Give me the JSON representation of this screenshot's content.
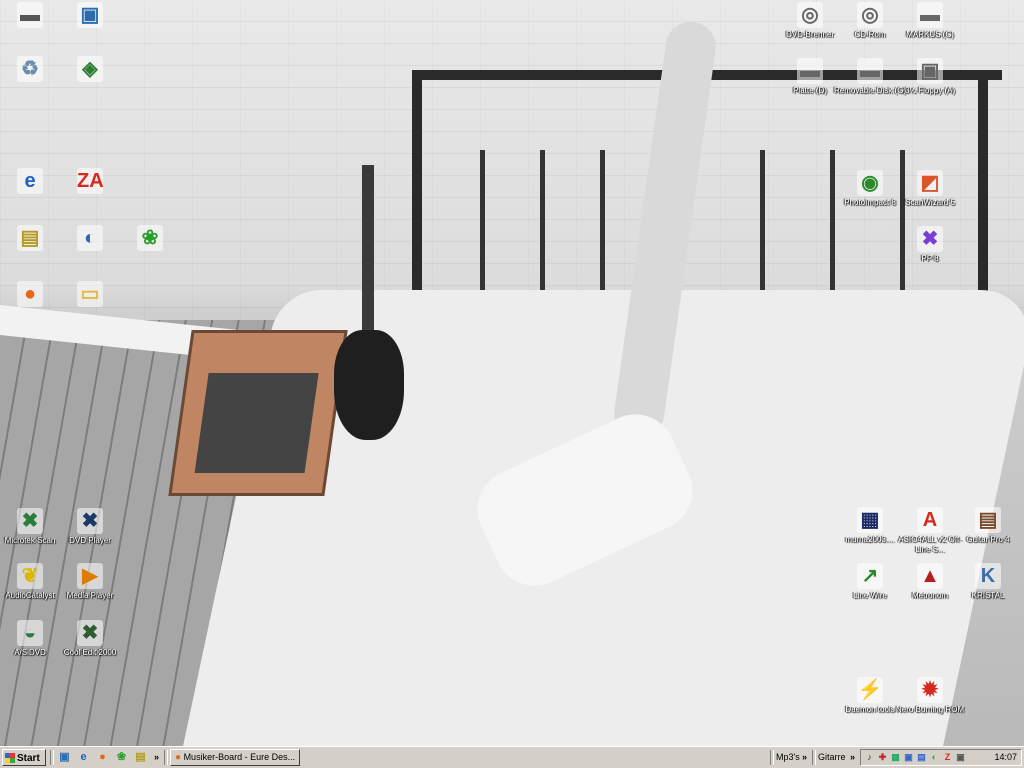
{
  "desktop": {
    "icons_left": [
      {
        "label": "",
        "glyph": "▬",
        "color": "#555",
        "name": "laptop-icon"
      },
      {
        "label": "",
        "glyph": "▣",
        "color": "#2b6cb0",
        "name": "my-computer-icon"
      },
      {
        "label": "",
        "glyph": "♻",
        "color": "#6b8fb0",
        "name": "recycle-bin-icon"
      },
      {
        "label": "",
        "glyph": "◈",
        "color": "#2f7d32",
        "name": "network-icon"
      },
      {
        "label": "",
        "glyph": "e",
        "color": "#1e64c8",
        "name": "internet-explorer-icon"
      },
      {
        "label": "",
        "glyph": "ZA",
        "color": "#d62a1e",
        "name": "zonealarm-icon"
      },
      {
        "label": "",
        "glyph": "▤",
        "color": "#b59b22",
        "name": "program-icon"
      },
      {
        "label": "",
        "glyph": "◐",
        "color": "#3366aa",
        "name": "network-places-icon"
      },
      {
        "label": "",
        "glyph": "❀",
        "color": "#2a9d2a",
        "name": "icq-icon"
      },
      {
        "label": "",
        "glyph": "●",
        "color": "#e8661a",
        "name": "firefox-icon"
      },
      {
        "label": "",
        "glyph": "▭",
        "color": "#e4b93c",
        "name": "folder-icon"
      }
    ],
    "icons_bottom_left": [
      {
        "label": "Microtek Scan",
        "glyph": "✖",
        "color": "#2a7d3a",
        "name": "microtek-scan-icon"
      },
      {
        "label": "DVD Player",
        "glyph": "✖",
        "color": "#1c3a66",
        "name": "dvd-player-icon"
      },
      {
        "label": "AudioCatalyst",
        "glyph": "❦",
        "color": "#d9b600",
        "name": "audiocatalyst-icon"
      },
      {
        "label": "Media Player",
        "glyph": "▶",
        "color": "#e07b00",
        "name": "media-player-icon"
      },
      {
        "label": "A/SiDVD",
        "glyph": "◒",
        "color": "#2a7d3a",
        "name": "asidvd-icon"
      },
      {
        "label": "Cool Edit 2000",
        "glyph": "✖",
        "color": "#2f5d2f",
        "name": "cool-edit-icon"
      }
    ],
    "drives": [
      {
        "label": "DVD-Brenner",
        "glyph": "◎",
        "name": "dvd-brenner-icon"
      },
      {
        "label": "CD-Rom",
        "glyph": "◎",
        "name": "cd-rom-icon"
      },
      {
        "label": "MARKUS (C)",
        "glyph": "▬",
        "name": "drive-c-icon"
      },
      {
        "label": "Platte (D)",
        "glyph": "▬",
        "name": "drive-d-icon"
      },
      {
        "label": "Removable Disk (G)",
        "glyph": "▬",
        "name": "removable-disk-icon"
      },
      {
        "label": "3½ Floppy (A)",
        "glyph": "▣",
        "name": "floppy-icon"
      }
    ],
    "icons_right_mid": [
      {
        "label": "PhotoImpact 8",
        "glyph": "◉",
        "color": "#2a8a2a",
        "name": "photoimpact-icon"
      },
      {
        "label": "ScanWizard 5",
        "glyph": "◩",
        "color": "#d9562a",
        "name": "scanwizard-icon"
      },
      {
        "label": "PP 8",
        "glyph": "✖",
        "color": "#7a3dd6",
        "name": "pp8-icon"
      }
    ],
    "icons_right_bottom": [
      {
        "label": "murna2003....",
        "glyph": "▦",
        "color": "#1a2a66",
        "name": "murna-icon"
      },
      {
        "label": "ASIO4ALL v2 Off-Line S...",
        "glyph": "A",
        "color": "#d62a1e",
        "name": "asio4all-icon"
      },
      {
        "label": "Guitar Pro 4",
        "glyph": "▤",
        "color": "#7a4a2a",
        "name": "guitar-pro-icon"
      },
      {
        "label": "Line Wire",
        "glyph": "↗",
        "color": "#2a8a2a",
        "name": "line-wire-icon"
      },
      {
        "label": "Metronom",
        "glyph": "▲",
        "color": "#b51e1e",
        "name": "metronom-icon"
      },
      {
        "label": "KRISTAL",
        "glyph": "K",
        "color": "#3a6ea8",
        "name": "kristal-icon"
      },
      {
        "label": "Daemon tools",
        "glyph": "⚡",
        "color": "#1e4aa8",
        "name": "daemon-tools-icon"
      },
      {
        "label": "Nero Burning ROM",
        "glyph": "✹",
        "color": "#d62a1e",
        "name": "nero-icon"
      }
    ]
  },
  "taskbar": {
    "start_label": "Start",
    "quick_launch": [
      {
        "glyph": "▣",
        "name": "show-desktop-icon",
        "color": "#2b6cb0"
      },
      {
        "glyph": "e",
        "name": "ie-quicklaunch-icon",
        "color": "#1e64c8"
      },
      {
        "glyph": "●",
        "name": "firefox-quicklaunch-icon",
        "color": "#e8661a"
      },
      {
        "glyph": "❀",
        "name": "icq-quicklaunch-icon",
        "color": "#2a9d2a"
      },
      {
        "glyph": "▤",
        "name": "app-quicklaunch-icon",
        "color": "#b59b22"
      }
    ],
    "overflow_label": "»",
    "task_label": "Musiker-Board - Eure Des...",
    "toolbar_mp3": "Mp3's",
    "toolbar_gitarre": "Gitarre",
    "clock": "14:07",
    "tray": [
      {
        "glyph": "♪",
        "color": "#333",
        "name": "volume-icon"
      },
      {
        "glyph": "✚",
        "color": "#c22",
        "name": "tray-red-icon"
      },
      {
        "glyph": "▦",
        "color": "#2a6",
        "name": "tray-green-icon"
      },
      {
        "glyph": "▣",
        "color": "#36c",
        "name": "tray-monitor-icon"
      },
      {
        "glyph": "▤",
        "color": "#36c",
        "name": "tray-network-icon"
      },
      {
        "glyph": "◐",
        "color": "#3a3",
        "name": "tray-icq-icon"
      },
      {
        "glyph": "Z",
        "color": "#d62a1e",
        "name": "tray-zonealarm-icon"
      },
      {
        "glyph": "▣",
        "color": "#555",
        "name": "tray-misc-icon"
      }
    ]
  }
}
